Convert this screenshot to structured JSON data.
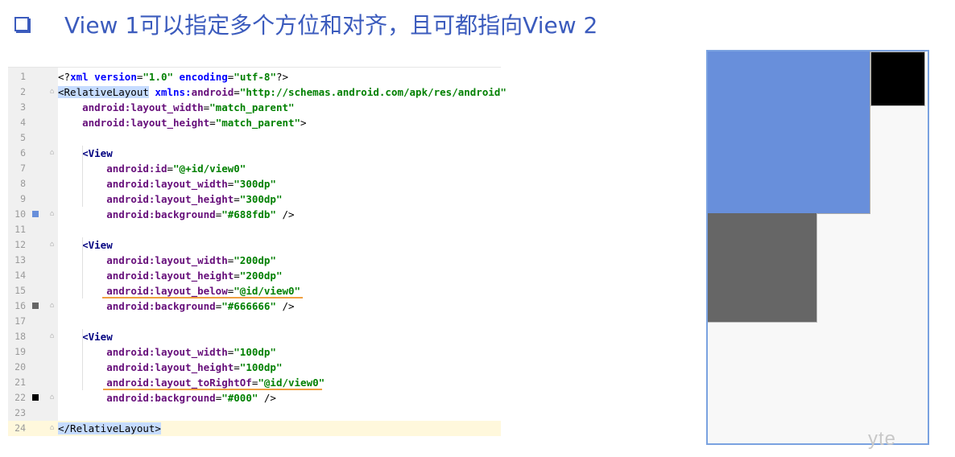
{
  "title": {
    "text": "View 1可以指定多个方位和对齐，且可都指向View 2"
  },
  "code": {
    "lines": [
      {
        "n": "1",
        "parts": [
          [
            "pun",
            "<?"
          ],
          [
            "ns",
            "xml version"
          ],
          [
            "pun",
            "="
          ],
          [
            "val",
            "\"1.0\""
          ],
          [
            "ns",
            " encoding"
          ],
          [
            "pun",
            "="
          ],
          [
            "val",
            "\"utf-8\""
          ],
          [
            "pun",
            "?>"
          ]
        ]
      },
      {
        "n": "2",
        "parts": [
          [
            "sel",
            "<RelativeLayout"
          ],
          [
            "ns",
            " xmlns:"
          ],
          [
            "attr",
            "android"
          ],
          [
            "pun",
            "="
          ],
          [
            "val",
            "\"http://schemas.android.com/apk/res/android\""
          ]
        ]
      },
      {
        "n": "3",
        "parts": [
          [
            "pun",
            "    "
          ],
          [
            "attr",
            "android:layout_width"
          ],
          [
            "pun",
            "="
          ],
          [
            "val",
            "\"match_parent\""
          ]
        ]
      },
      {
        "n": "4",
        "parts": [
          [
            "pun",
            "    "
          ],
          [
            "attr",
            "android:layout_height"
          ],
          [
            "pun",
            "="
          ],
          [
            "val",
            "\"match_parent\""
          ],
          [
            "pun",
            ">"
          ]
        ]
      },
      {
        "n": "5",
        "parts": []
      },
      {
        "n": "6",
        "parts": [
          [
            "pun",
            "    "
          ],
          [
            "tag",
            "<View"
          ]
        ]
      },
      {
        "n": "7",
        "parts": [
          [
            "pun",
            "        "
          ],
          [
            "attr",
            "android:id"
          ],
          [
            "pun",
            "="
          ],
          [
            "val",
            "\"@+id/view0\""
          ]
        ]
      },
      {
        "n": "8",
        "parts": [
          [
            "pun",
            "        "
          ],
          [
            "attr",
            "android:layout_width"
          ],
          [
            "pun",
            "="
          ],
          [
            "val",
            "\"300dp\""
          ]
        ]
      },
      {
        "n": "9",
        "parts": [
          [
            "pun",
            "        "
          ],
          [
            "attr",
            "android:layout_height"
          ],
          [
            "pun",
            "="
          ],
          [
            "val",
            "\"300dp\""
          ]
        ]
      },
      {
        "n": "10",
        "parts": [
          [
            "pun",
            "        "
          ],
          [
            "attr",
            "android:background"
          ],
          [
            "pun",
            "="
          ],
          [
            "val",
            "\"#688fdb\""
          ],
          [
            "pun",
            " />"
          ]
        ]
      },
      {
        "n": "11",
        "parts": []
      },
      {
        "n": "12",
        "parts": [
          [
            "pun",
            "    "
          ],
          [
            "tag",
            "<View"
          ]
        ]
      },
      {
        "n": "13",
        "parts": [
          [
            "pun",
            "        "
          ],
          [
            "attr",
            "android:layout_width"
          ],
          [
            "pun",
            "="
          ],
          [
            "val",
            "\"200dp\""
          ]
        ]
      },
      {
        "n": "14",
        "parts": [
          [
            "pun",
            "        "
          ],
          [
            "attr",
            "android:layout_height"
          ],
          [
            "pun",
            "="
          ],
          [
            "val",
            "\"200dp\""
          ]
        ]
      },
      {
        "n": "15",
        "parts": [
          [
            "pun",
            "        "
          ],
          [
            "attr",
            "android:layout_below"
          ],
          [
            "pun",
            "="
          ],
          [
            "val",
            "\"@id/view0\""
          ]
        ]
      },
      {
        "n": "16",
        "parts": [
          [
            "pun",
            "        "
          ],
          [
            "attr",
            "android:background"
          ],
          [
            "pun",
            "="
          ],
          [
            "val",
            "\"#666666\""
          ],
          [
            "pun",
            " />"
          ]
        ]
      },
      {
        "n": "17",
        "parts": []
      },
      {
        "n": "18",
        "parts": [
          [
            "pun",
            "    "
          ],
          [
            "tag",
            "<View"
          ]
        ]
      },
      {
        "n": "19",
        "parts": [
          [
            "pun",
            "        "
          ],
          [
            "attr",
            "android:layout_width"
          ],
          [
            "pun",
            "="
          ],
          [
            "val",
            "\"100dp\""
          ]
        ]
      },
      {
        "n": "20",
        "parts": [
          [
            "pun",
            "        "
          ],
          [
            "attr",
            "android:layout_height"
          ],
          [
            "pun",
            "="
          ],
          [
            "val",
            "\"100dp\""
          ]
        ]
      },
      {
        "n": "21",
        "parts": [
          [
            "pun",
            "        "
          ],
          [
            "attr",
            "android:layout_toRightOf"
          ],
          [
            "pun",
            "="
          ],
          [
            "val",
            "\"@id/view0\""
          ]
        ]
      },
      {
        "n": "22",
        "parts": [
          [
            "pun",
            "        "
          ],
          [
            "attr",
            "android:background"
          ],
          [
            "pun",
            "="
          ],
          [
            "val",
            "\"#000\""
          ],
          [
            "pun",
            " />"
          ]
        ]
      },
      {
        "n": "23",
        "parts": []
      },
      {
        "n": "24",
        "parts": [
          [
            "sel",
            "</RelativeLayout>"
          ]
        ]
      }
    ]
  },
  "markers": {
    "10": "#688fdb",
    "16": "#666666",
    "22": "#000000"
  },
  "watermark": {
    "text": "yte"
  }
}
